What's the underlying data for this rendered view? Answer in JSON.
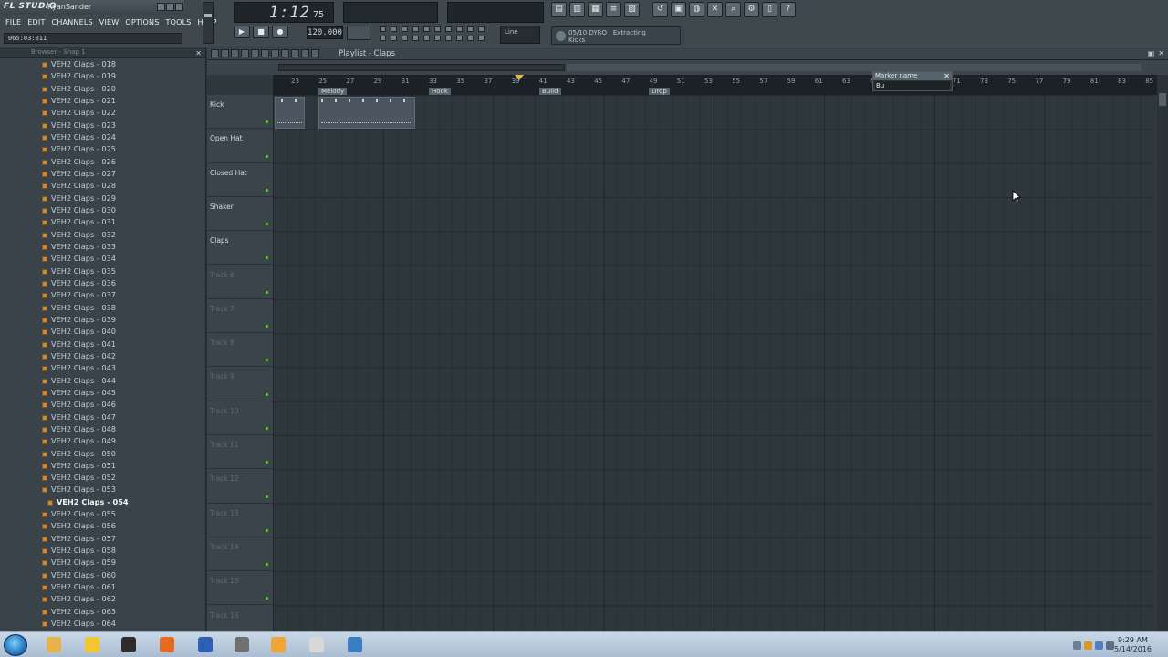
{
  "app": {
    "logo": "FL STUDIO",
    "user": "RyanSander",
    "menu": [
      "FILE",
      "EDIT",
      "CHANNELS",
      "VIEW",
      "OPTIONS",
      "TOOLS",
      "HELP"
    ],
    "hint": "065:03:011"
  },
  "transport": {
    "time_main": "1:12",
    "time_sub": "75",
    "tempo": "120.000",
    "snap_mode": "Line",
    "hint_panel_line1": "05/10 DYRO | Extracting",
    "hint_panel_line2": "Kicks"
  },
  "browser": {
    "header": "Browser - Snap 1",
    "selected_index": 36,
    "items": [
      "VEH2 Claps - 018",
      "VEH2 Claps - 019",
      "VEH2 Claps - 020",
      "VEH2 Claps - 021",
      "VEH2 Claps - 022",
      "VEH2 Claps - 023",
      "VEH2 Claps - 024",
      "VEH2 Claps - 025",
      "VEH2 Claps - 026",
      "VEH2 Claps - 027",
      "VEH2 Claps - 028",
      "VEH2 Claps - 029",
      "VEH2 Claps - 030",
      "VEH2 Claps - 031",
      "VEH2 Claps - 032",
      "VEH2 Claps - 033",
      "VEH2 Claps - 034",
      "VEH2 Claps - 035",
      "VEH2 Claps - 036",
      "VEH2 Claps - 037",
      "VEH2 Claps - 038",
      "VEH2 Claps - 039",
      "VEH2 Claps - 040",
      "VEH2 Claps - 041",
      "VEH2 Claps - 042",
      "VEH2 Claps - 043",
      "VEH2 Claps - 044",
      "VEH2 Claps - 045",
      "VEH2 Claps - 046",
      "VEH2 Claps - 047",
      "VEH2 Claps - 048",
      "VEH2 Claps - 049",
      "VEH2 Claps - 050",
      "VEH2 Claps - 051",
      "VEH2 Claps - 052",
      "VEH2 Claps - 053",
      "VEH2 Claps - 054",
      "VEH2 Claps - 055",
      "VEH2 Claps - 056",
      "VEH2 Claps - 057",
      "VEH2 Claps - 058",
      "VEH2 Claps - 059",
      "VEH2 Claps - 060",
      "VEH2 Claps - 061",
      "VEH2 Claps - 062",
      "VEH2 Claps - 063",
      "VEH2 Claps - 064"
    ]
  },
  "playlist": {
    "title": "Playlist - Claps",
    "ruler_numbers": [
      "23",
      "25",
      "27",
      "29",
      "31",
      "33",
      "35",
      "37",
      "39",
      "41",
      "43",
      "45",
      "47",
      "49",
      "51",
      "53",
      "55",
      "57",
      "59",
      "61",
      "63",
      "65",
      "67",
      "69",
      "71",
      "73",
      "75",
      "77",
      "79",
      "81",
      "83",
      "85"
    ],
    "markers": [
      "Melody",
      "Hook",
      "Build",
      "Drop"
    ],
    "marker_popup": {
      "title": "Marker name",
      "value": "Bu"
    },
    "tracks": [
      {
        "name": "Kick",
        "empty": false
      },
      {
        "name": "Open Hat",
        "empty": false
      },
      {
        "name": "Closed Hat",
        "empty": false
      },
      {
        "name": "Shaker",
        "empty": false
      },
      {
        "name": "Claps",
        "empty": false
      },
      {
        "name": "Track 6",
        "empty": true
      },
      {
        "name": "Track 7",
        "empty": true
      },
      {
        "name": "Track 8",
        "empty": true
      },
      {
        "name": "Track 9",
        "empty": true
      },
      {
        "name": "Track 10",
        "empty": true
      },
      {
        "name": "Track 11",
        "empty": true
      },
      {
        "name": "Track 12",
        "empty": true
      },
      {
        "name": "Track 13",
        "empty": true
      },
      {
        "name": "Track 14",
        "empty": true
      },
      {
        "name": "Track 15",
        "empty": true
      },
      {
        "name": "Track 16",
        "empty": true
      }
    ]
  },
  "taskbar": {
    "time": "9:29 AM",
    "date": "5/14/2016",
    "apps": [
      "explorer-icon",
      "norton-icon",
      "fl-studio-icon",
      "firefox-icon",
      "audacity-icon",
      "tool-icon",
      "media-player-icon",
      "steam-icon",
      "screen-capture-icon"
    ]
  }
}
